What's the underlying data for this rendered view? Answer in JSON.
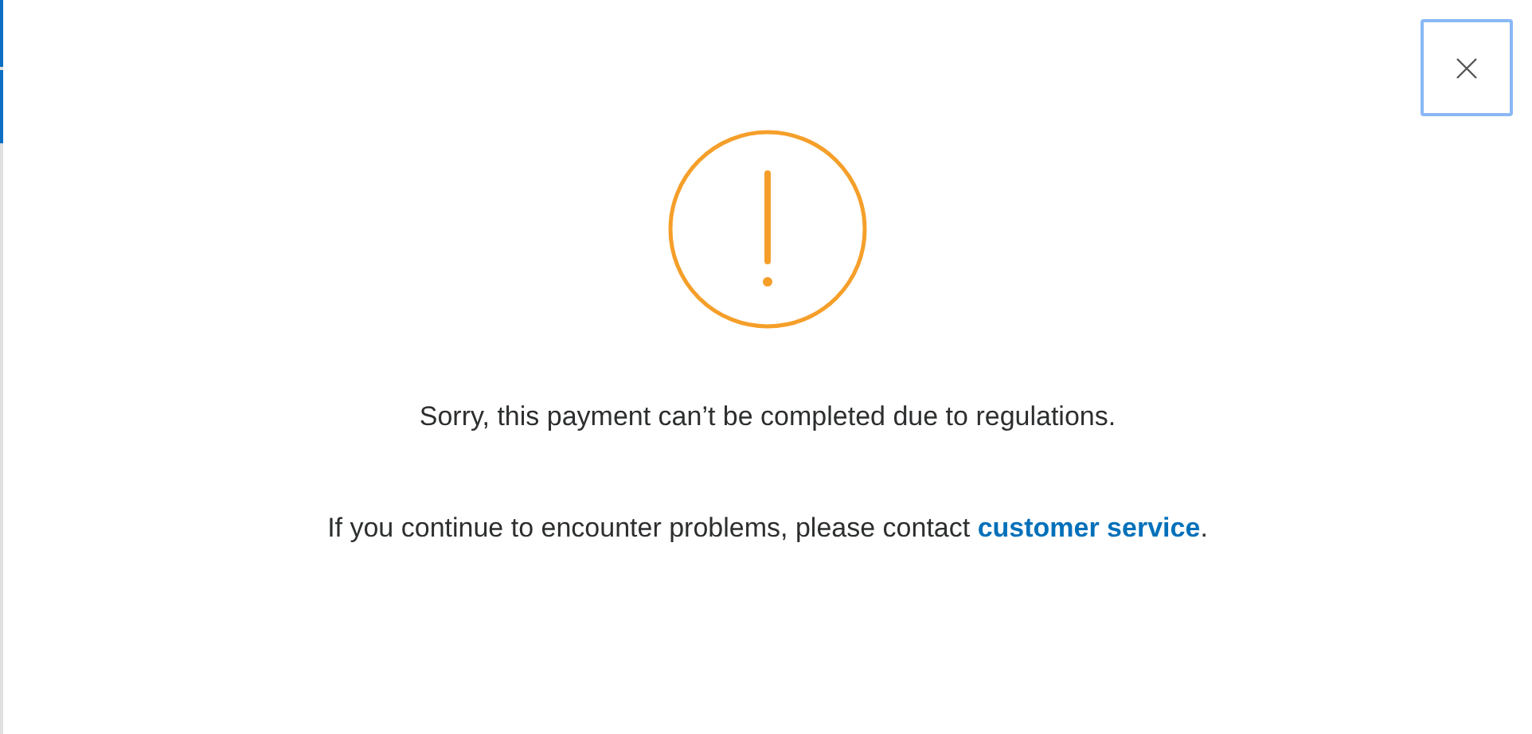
{
  "dialog": {
    "message": "Sorry, this payment can’t be completed due to regulations.",
    "help_text": "If you continue to encounter problems, please contact ",
    "help_link": "customer service",
    "help_suffix": "."
  }
}
